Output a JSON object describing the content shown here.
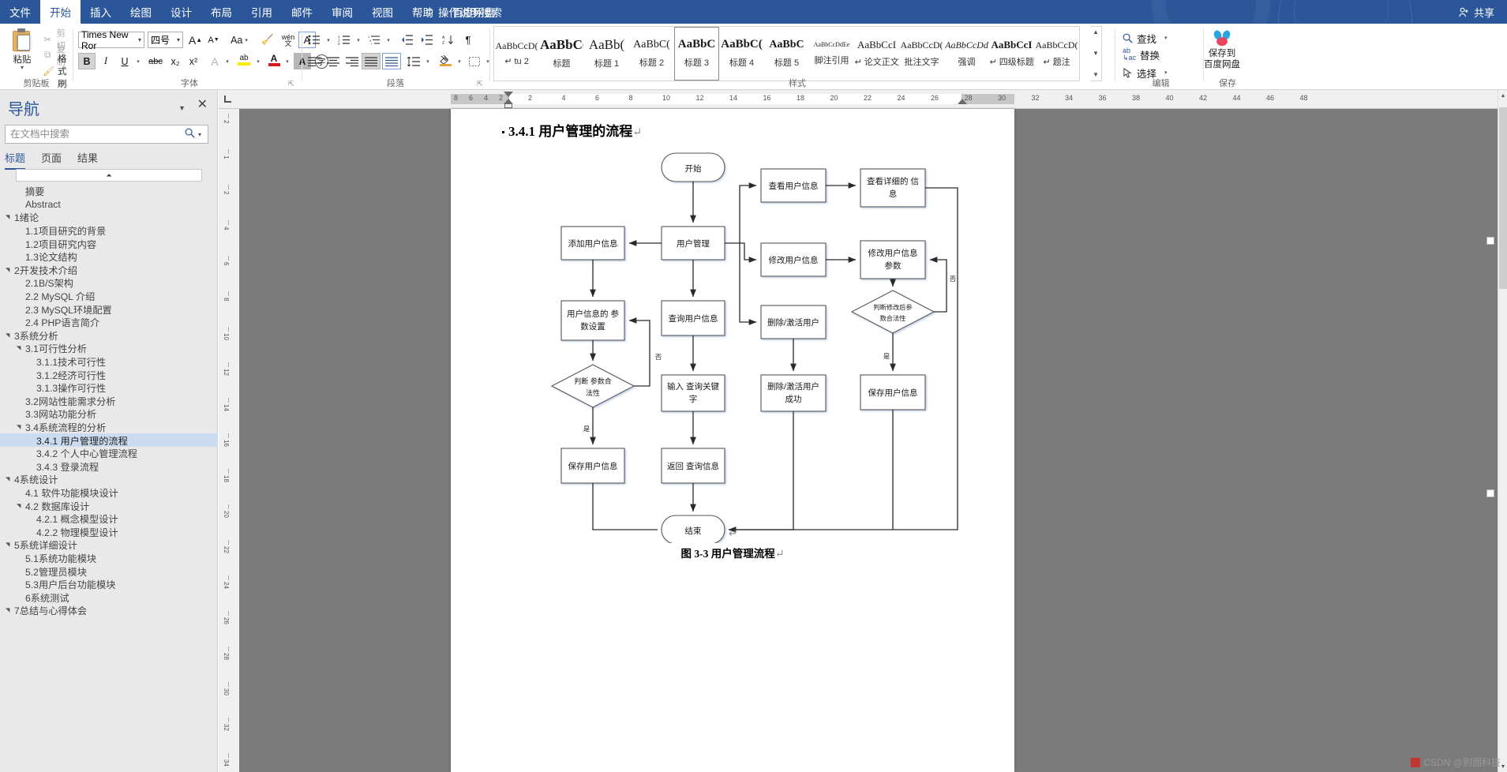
{
  "titlebar": {
    "share_label": "共享",
    "share_icon": "person-add-icon"
  },
  "ribbon": {
    "tabs": [
      {
        "label": "文件",
        "active": false
      },
      {
        "label": "开始",
        "active": true
      },
      {
        "label": "插入",
        "active": false
      },
      {
        "label": "绘图",
        "active": false
      },
      {
        "label": "设计",
        "active": false
      },
      {
        "label": "布局",
        "active": false
      },
      {
        "label": "引用",
        "active": false
      },
      {
        "label": "邮件",
        "active": false
      },
      {
        "label": "审阅",
        "active": false
      },
      {
        "label": "视图",
        "active": false
      },
      {
        "label": "帮助",
        "active": false
      },
      {
        "label": "百度网盘",
        "active": false
      }
    ],
    "tell_me": "操作说明搜索",
    "groups": {
      "clipboard": {
        "label": "剪贴板",
        "paste_label": "粘贴",
        "cut_label": "剪切",
        "copy_label": "复制",
        "format_painter_label": "格式刷"
      },
      "font": {
        "label": "字体",
        "font_name": "Times New Ror",
        "font_size": "四号",
        "grow_font": "A",
        "shrink_font": "A",
        "change_case": "Aa",
        "clear_format": "清除格式",
        "phonetic": "拼音指南",
        "char_border": "字符边框",
        "bold": "B",
        "italic": "I",
        "underline": "U",
        "strikethrough": "abc",
        "subscript": "x₂",
        "superscript": "x²",
        "text_effects": "A",
        "highlight": "ab",
        "font_color": "A",
        "char_shading": "A",
        "enclose_char": "字"
      },
      "paragraph": {
        "label": "段落"
      },
      "styles": {
        "label": "样式",
        "items": [
          {
            "preview": "AaBbCcD(",
            "name": "↵ tu 2",
            "size": 12,
            "weight": "normal",
            "style": "normal",
            "selected": false
          },
          {
            "preview": "AaBbC(",
            "name": "标题",
            "size": 17,
            "weight": "bold",
            "style": "normal",
            "selected": false
          },
          {
            "preview": "AaBb(",
            "name": "标题 1",
            "size": 17,
            "weight": "normal",
            "style": "normal",
            "selected": false
          },
          {
            "preview": "AaBbC(",
            "name": "标题 2",
            "size": 14,
            "weight": "normal",
            "style": "normal",
            "selected": false
          },
          {
            "preview": "AaBbC",
            "name": "标题 3",
            "size": 15,
            "weight": "bold",
            "style": "normal",
            "selected": true
          },
          {
            "preview": "AaBbC(",
            "name": "标题 4",
            "size": 15,
            "weight": "bold",
            "style": "normal",
            "selected": false
          },
          {
            "preview": "AaBbC",
            "name": "标题 5",
            "size": 14,
            "weight": "bold",
            "style": "normal",
            "selected": false
          },
          {
            "preview": "AaBbCcDdEe",
            "name": "脚注引用",
            "size": 8,
            "weight": "normal",
            "style": "normal",
            "selected": false
          },
          {
            "preview": "AaBbCcI",
            "name": "↵ 论文正文",
            "size": 13,
            "weight": "normal",
            "style": "normal",
            "selected": false
          },
          {
            "preview": "AaBbCcD(",
            "name": "批注文字",
            "size": 12,
            "weight": "normal",
            "style": "normal",
            "selected": false
          },
          {
            "preview": "AaBbCcDd",
            "name": "强调",
            "size": 12,
            "weight": "normal",
            "style": "italic",
            "selected": false
          },
          {
            "preview": "AaBbCcI",
            "name": "↵ 四级标题",
            "size": 13,
            "weight": "bold",
            "style": "normal",
            "selected": false
          },
          {
            "preview": "AaBbCcD(",
            "name": "↵ 题注",
            "size": 12,
            "weight": "normal",
            "style": "normal",
            "selected": false
          }
        ]
      },
      "editing": {
        "label": "编辑",
        "find": "查找",
        "replace": "替换",
        "select": "选择"
      },
      "baidu": {
        "label": "保存",
        "button_line1": "保存到",
        "button_line2": "百度网盘"
      }
    }
  },
  "navigation": {
    "title": "导航",
    "search_placeholder": "在文档中搜索",
    "search_value": "",
    "tabs": [
      {
        "label": "标题",
        "active": true
      },
      {
        "label": "页面",
        "active": false
      },
      {
        "label": "结果",
        "active": false
      }
    ],
    "items": [
      {
        "label": "摘要",
        "indent": 1,
        "expandable": false,
        "selected": false
      },
      {
        "label": "Abstract",
        "indent": 1,
        "expandable": false,
        "selected": false
      },
      {
        "label": "1绪论",
        "indent": 0,
        "expandable": true,
        "selected": false
      },
      {
        "label": "1.1项目研究的背景",
        "indent": 1,
        "expandable": false,
        "selected": false
      },
      {
        "label": "1.2项目研究内容",
        "indent": 1,
        "expandable": false,
        "selected": false
      },
      {
        "label": "1.3论文结构",
        "indent": 1,
        "expandable": false,
        "selected": false
      },
      {
        "label": "2开发技术介绍",
        "indent": 0,
        "expandable": true,
        "selected": false
      },
      {
        "label": "2.1B/S架构",
        "indent": 1,
        "expandable": false,
        "selected": false
      },
      {
        "label": "2.2 MySQL 介绍",
        "indent": 1,
        "expandable": false,
        "selected": false
      },
      {
        "label": "2.3 MySQL环境配置",
        "indent": 1,
        "expandable": false,
        "selected": false
      },
      {
        "label": "2.4 PHP语言简介",
        "indent": 1,
        "expandable": false,
        "selected": false
      },
      {
        "label": "3系统分析",
        "indent": 0,
        "expandable": true,
        "selected": false
      },
      {
        "label": "3.1可行性分析",
        "indent": 1,
        "expandable": true,
        "selected": false
      },
      {
        "label": "3.1.1技术可行性",
        "indent": 2,
        "expandable": false,
        "selected": false
      },
      {
        "label": "3.1.2经济可行性",
        "indent": 2,
        "expandable": false,
        "selected": false
      },
      {
        "label": "3.1.3操作可行性",
        "indent": 2,
        "expandable": false,
        "selected": false
      },
      {
        "label": "3.2网站性能需求分析",
        "indent": 1,
        "expandable": false,
        "selected": false
      },
      {
        "label": "3.3网站功能分析",
        "indent": 1,
        "expandable": false,
        "selected": false
      },
      {
        "label": "3.4系统流程的分析",
        "indent": 1,
        "expandable": true,
        "selected": false
      },
      {
        "label": "3.4.1 用户管理的流程",
        "indent": 2,
        "expandable": false,
        "selected": true
      },
      {
        "label": "3.4.2 个人中心管理流程",
        "indent": 2,
        "expandable": false,
        "selected": false
      },
      {
        "label": "3.4.3 登录流程",
        "indent": 2,
        "expandable": false,
        "selected": false
      },
      {
        "label": "4系统设计",
        "indent": 0,
        "expandable": true,
        "selected": false
      },
      {
        "label": "4.1 软件功能模块设计",
        "indent": 1,
        "expandable": false,
        "selected": false
      },
      {
        "label": "4.2 数据库设计",
        "indent": 1,
        "expandable": true,
        "selected": false
      },
      {
        "label": "4.2.1 概念模型设计",
        "indent": 2,
        "expandable": false,
        "selected": false
      },
      {
        "label": "4.2.2 物理模型设计",
        "indent": 2,
        "expandable": false,
        "selected": false
      },
      {
        "label": "5系统详细设计",
        "indent": 0,
        "expandable": true,
        "selected": false
      },
      {
        "label": "5.1系统功能模块",
        "indent": 1,
        "expandable": false,
        "selected": false
      },
      {
        "label": "5.2管理员模块",
        "indent": 1,
        "expandable": false,
        "selected": false
      },
      {
        "label": "5.3用户后台功能模块",
        "indent": 1,
        "expandable": false,
        "selected": false
      },
      {
        "label": "6系统测试",
        "indent": 1,
        "expandable": false,
        "selected": false
      },
      {
        "label": "7总结与心得体会",
        "indent": 0,
        "expandable": true,
        "selected": false
      }
    ]
  },
  "ruler": {
    "horizontal_ticks": [
      "8",
      "6",
      "4",
      "2",
      "2",
      "4",
      "6",
      "8",
      "10",
      "12",
      "14",
      "16",
      "18",
      "20",
      "22",
      "24",
      "26",
      "28",
      "30",
      "32",
      "34",
      "36",
      "38",
      "40",
      "42",
      "44",
      "46",
      "48"
    ],
    "vertical_ticks": [
      "2",
      "1",
      "2",
      "4",
      "6",
      "8",
      "10",
      "12",
      "14",
      "16",
      "18",
      "20",
      "22",
      "24",
      "26",
      "28",
      "30",
      "32",
      "34"
    ]
  },
  "document": {
    "heading": "3.4.1  用户管理的流程",
    "heading_pilcrow": "↵",
    "figure_caption": "图 3-3  用户管理流程",
    "caption_pilcrow": "↵",
    "paragraph_mark": "↵"
  },
  "flowchart": {
    "nodes": {
      "start": "开始",
      "user_manage": "用户管理",
      "add_user": "添加用户信息",
      "add_param": "用户信息的 参\n数设置",
      "add_param_l1": "用户信息的 参",
      "add_param_l2": "数设置",
      "decide_param": "判断 参数合\n法性",
      "decide_param_l1": "判断 参数合",
      "decide_param_l2": "法性",
      "save_user_left": "保存用户信息",
      "query_user": "查询用户信息",
      "input_keyword_l1": "输入 查询关键",
      "input_keyword_l2": "字",
      "return_query": "返回 查询信息",
      "view_user": "查看用户信息",
      "modify_user": "修改用户信息",
      "delete_activate": "删除/激活用户",
      "delete_activate_ok_l1": "删除/激活用户",
      "delete_activate_ok_l2": "成功",
      "view_detail_l1": "查看详细的 信",
      "view_detail_l2": "息",
      "modify_params_l1": "修改用户信息",
      "modify_params_l2": "参数",
      "decide_modified_l1": "判断修改后参",
      "decide_modified_l2": "数合法性",
      "save_user_right": "保存用户信息",
      "end": "结束"
    },
    "edge_labels": {
      "no_left": "否",
      "yes_left": "是",
      "no_right": "否",
      "yes_right": "是"
    }
  },
  "watermark": {
    "text": "CSDN @别圆科技"
  }
}
